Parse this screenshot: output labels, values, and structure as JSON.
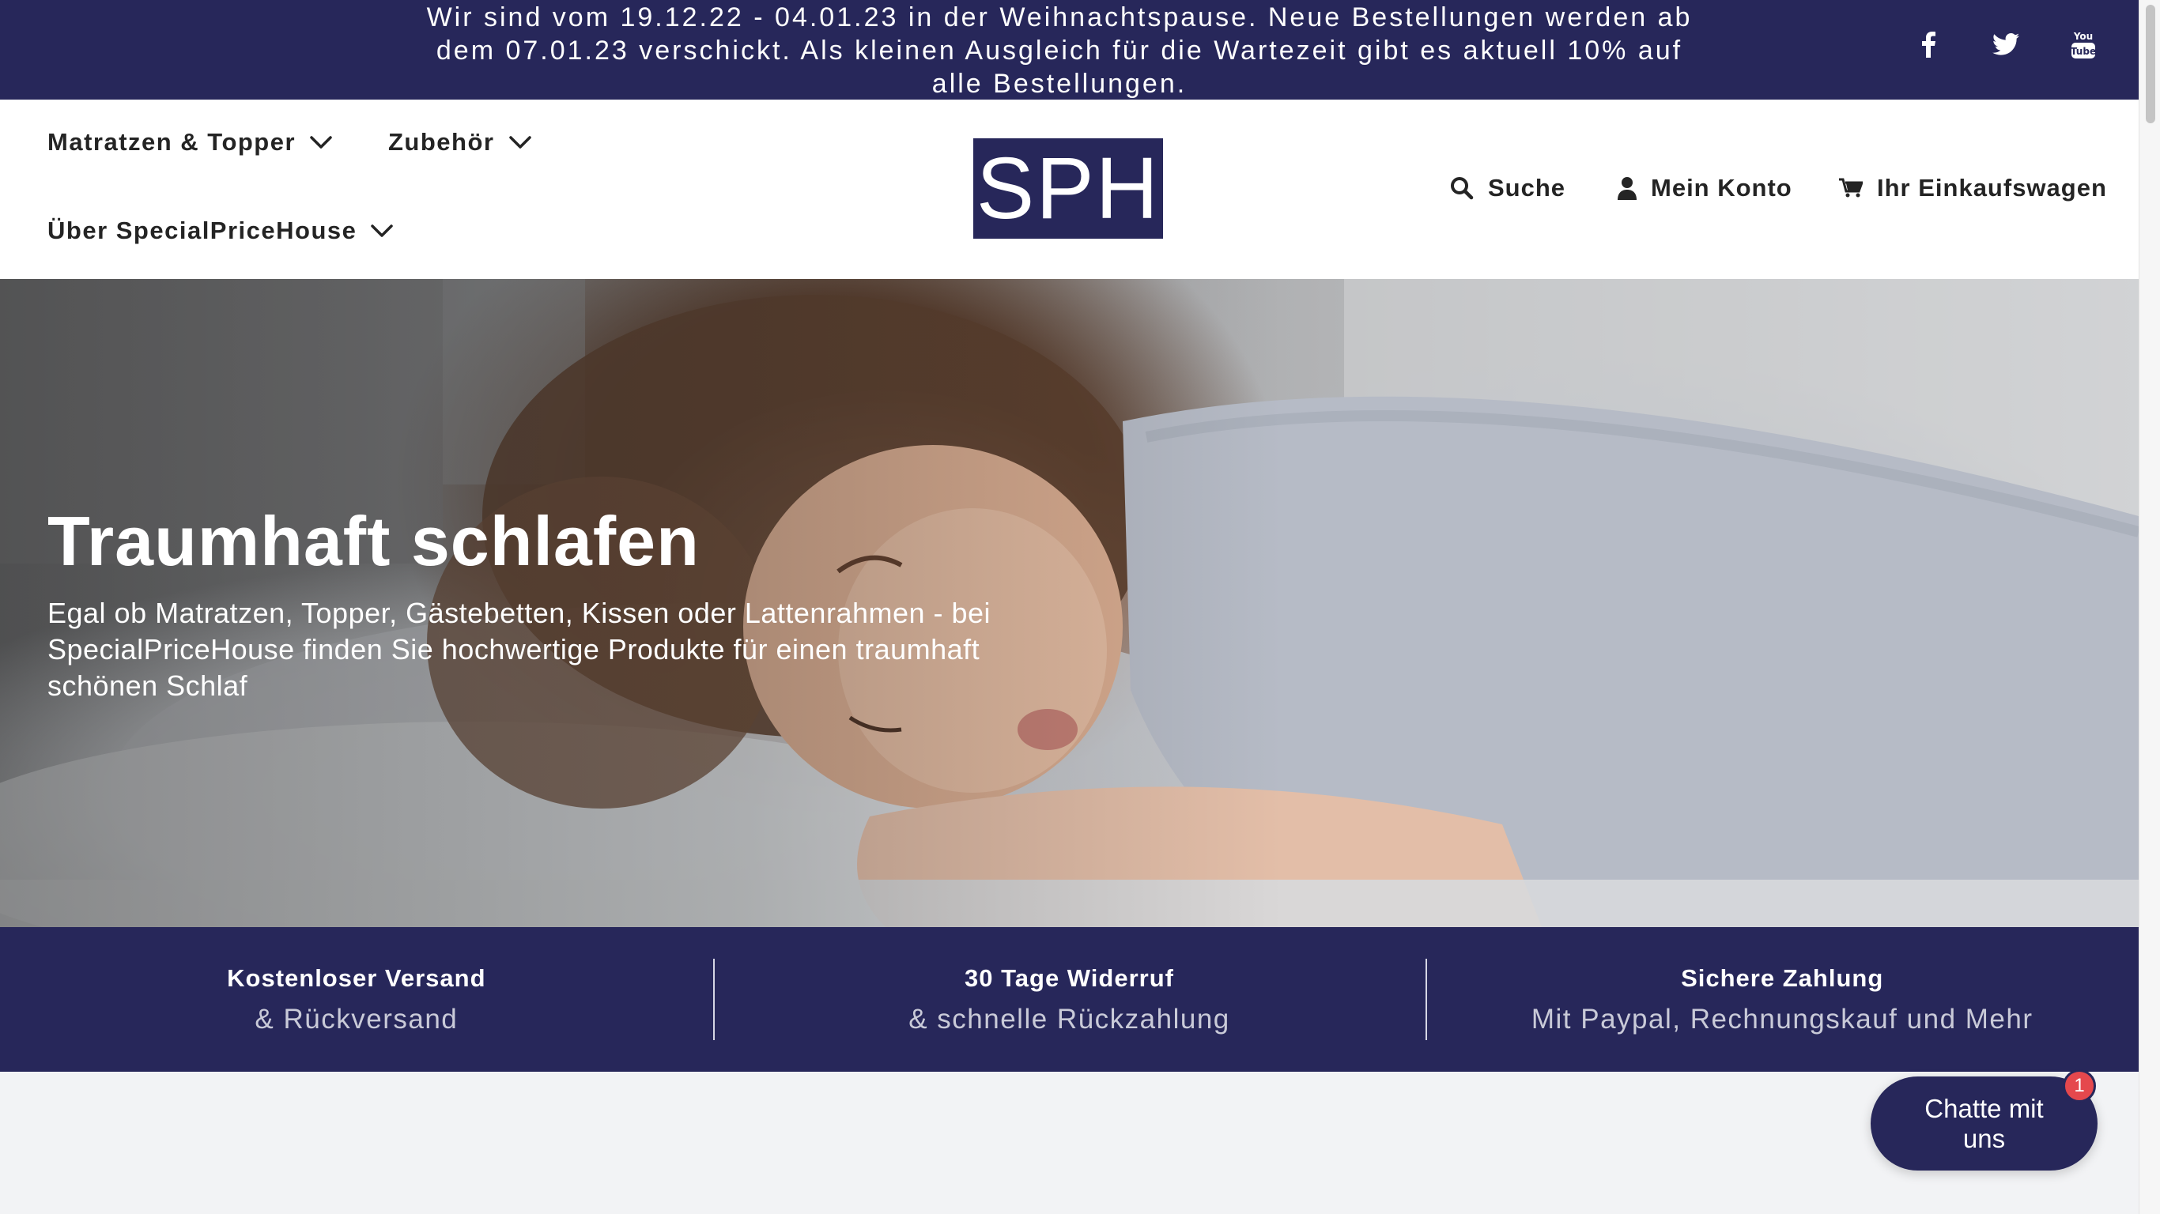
{
  "announcement": {
    "text": "Wir sind vom 19.12.22 - 04.01.23 in der Weihnachtspause. Neue Bestellungen werden ab dem 07.01.23 verschickt. Als kleinen Ausgleich für die Wartezeit gibt es aktuell 10% auf alle Bestellungen.",
    "social_icons": [
      "facebook-icon",
      "twitter-icon",
      "youtube-icon"
    ]
  },
  "nav": {
    "items": [
      {
        "label": "Matratzen & Topper"
      },
      {
        "label": "Zubehör"
      },
      {
        "label": "Über SpecialPriceHouse"
      }
    ]
  },
  "logo": {
    "text": "SPH"
  },
  "utility": {
    "search_label": "Suche",
    "account_label": "Mein Konto",
    "cart_label": "Ihr Einkaufswagen"
  },
  "hero": {
    "title": "Traumhaft schlafen",
    "text": "Egal ob Matratzen, Topper, Gästebetten, Kissen oder Lattenrahmen - bei SpecialPriceHouse finden Sie hochwertige Produkte für einen traumhaft schönen Schlaf"
  },
  "features": [
    {
      "title": "Kostenloser Versand",
      "sub": "& Rückversand"
    },
    {
      "title": "30 Tage Widerruf",
      "sub": "& schnelle Rückzahlung"
    },
    {
      "title": "Sichere Zahlung",
      "sub": "Mit Paypal, Rechnungskauf und Mehr"
    }
  ],
  "chat": {
    "label": "Chatte mit uns",
    "badge": "1"
  },
  "colors": {
    "brand": "#27275a",
    "badge": "#e5484d"
  }
}
